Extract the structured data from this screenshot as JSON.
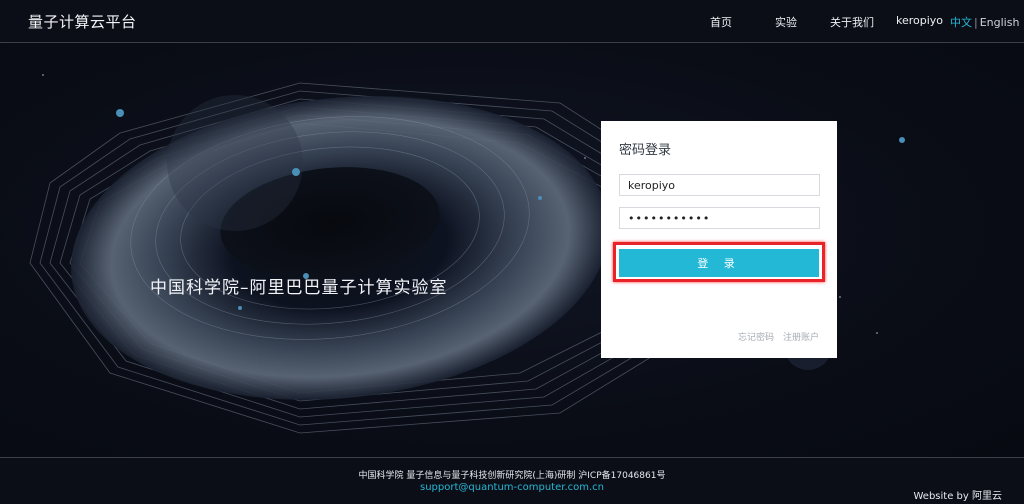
{
  "header": {
    "brand": "量子计算云平台",
    "nav": {
      "home": "首页",
      "experiment": "实验",
      "about": "关于我们",
      "user": "keropiyo"
    },
    "lang": {
      "zh": "中文",
      "separator": "|",
      "en": "English"
    }
  },
  "hero": {
    "title": "中国科学院–阿里巴巴量子计算实验室"
  },
  "login": {
    "title": "密码登录",
    "username_value": "keropiyo",
    "password_value": "•••••••••••",
    "submit_label": "登 录",
    "forgot_label": "忘记密码",
    "register_label": "注册账户",
    "accent_color": "#22b8d6",
    "highlight_color": "#e8232a"
  },
  "footer": {
    "line1": "中国科学院 量子信息与量子科技创新研究院(上海)研制 沪ICP备17046861号",
    "email": "support@quantum-computer.com.cn",
    "website": "Website by 阿里云"
  }
}
